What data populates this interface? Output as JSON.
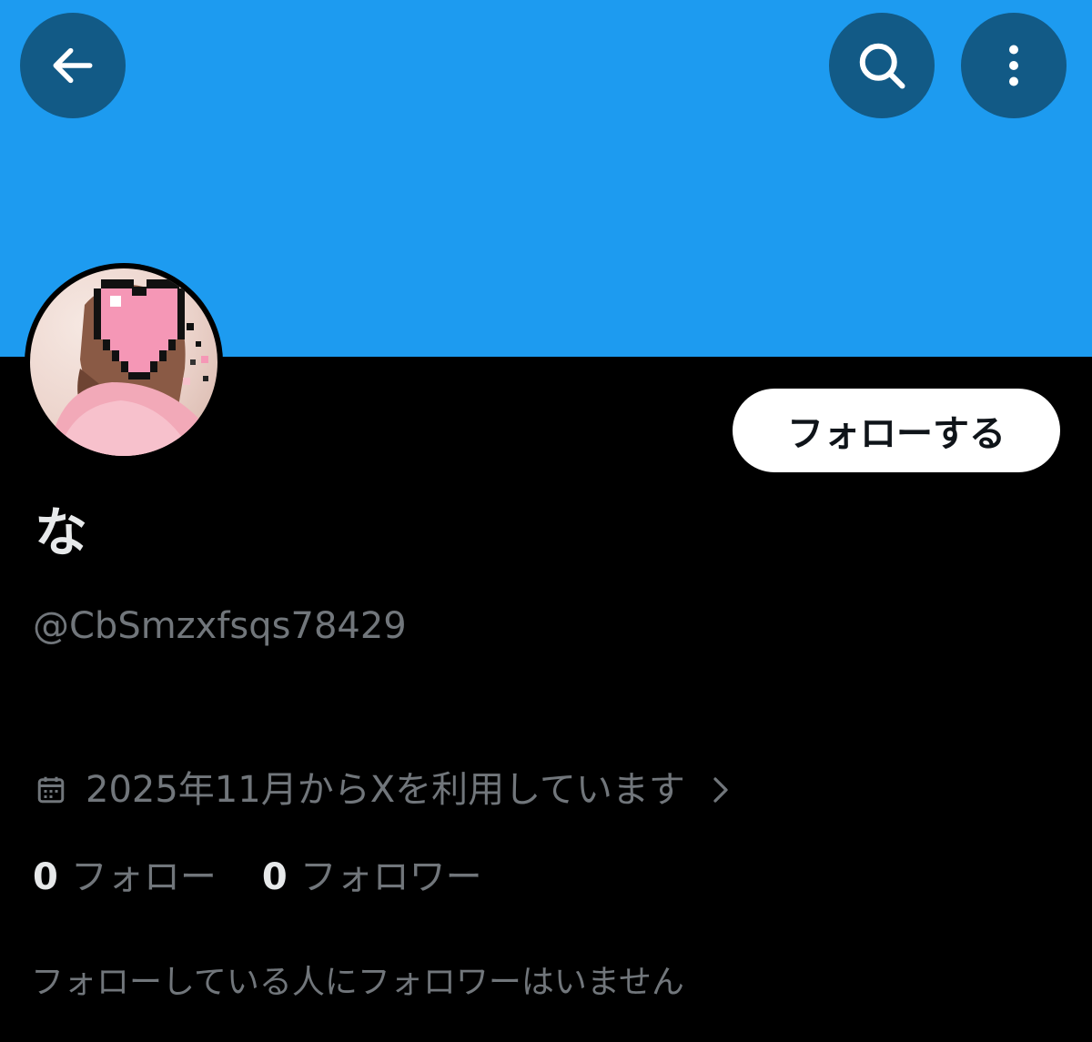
{
  "colors": {
    "banner": "#1d9bf0",
    "header_button": "#125a86",
    "background": "#000000",
    "primary_text": "#e7e9ea",
    "secondary_text": "#71767b"
  },
  "header": {
    "back_icon": "arrow-left-icon",
    "search_icon": "search-icon",
    "more_icon": "more-vertical-icon"
  },
  "profile": {
    "follow_button_label": "フォローする",
    "display_name": "な",
    "handle": "@CbSmzxfsqs78429",
    "joined": "2025年11月からXを利用しています",
    "following_count": "0",
    "following_label": "フォロー",
    "followers_count": "0",
    "followers_label": "フォロワー",
    "mutual_followers_text": "フォローしている人にフォロワーはいません"
  }
}
